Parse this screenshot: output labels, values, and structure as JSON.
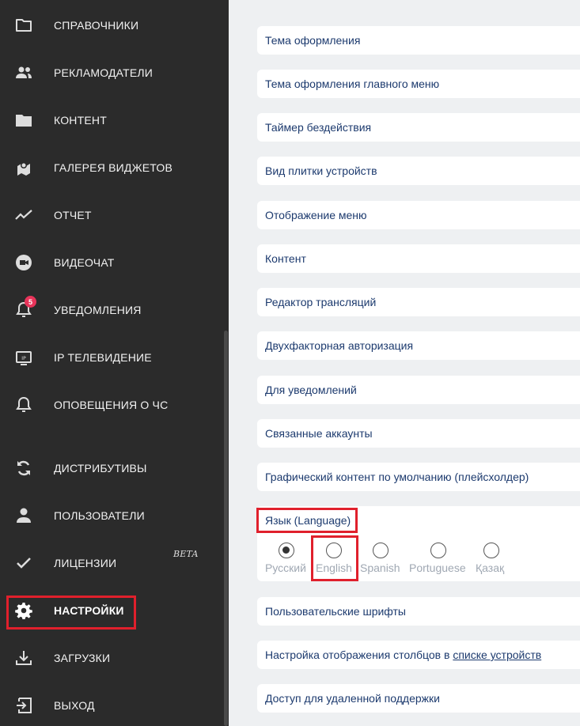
{
  "sidebar": {
    "items": [
      {
        "label": "СПРАВОЧНИКИ",
        "icon": "folder-icon"
      },
      {
        "label": "РЕКЛАМОДАТЕЛИ",
        "icon": "people-icon"
      },
      {
        "label": "КОНТЕНТ",
        "icon": "folder-filled-icon"
      },
      {
        "label": "ГАЛЕРЕЯ ВИДЖЕТОВ",
        "icon": "widgets-icon"
      },
      {
        "label": "ОТЧЕТ",
        "icon": "trend-line-icon"
      },
      {
        "label": "ВИДЕОЧАТ",
        "icon": "videochat-icon"
      },
      {
        "label": "УВЕДОМЛЕНИЯ",
        "icon": "bell-icon",
        "badge": "5"
      },
      {
        "label": "IP ТЕЛЕВИДЕНИЕ",
        "icon": "iptv-icon"
      },
      {
        "label": "ОПОВЕЩЕНИЯ О ЧС",
        "icon": "bell-outline-icon"
      },
      {
        "label": "ДИСТРИБУТИВЫ",
        "icon": "sync-icon"
      },
      {
        "label": "ПОЛЬЗОВАТЕЛИ",
        "icon": "user-icon"
      },
      {
        "label": "ЛИЦЕНЗИИ",
        "icon": "check-icon",
        "tag": "beta"
      },
      {
        "label": "НАСТРОЙКИ",
        "icon": "gear-icon",
        "active": true
      },
      {
        "label": "ЗАГРУЗКИ",
        "icon": "download-icon"
      },
      {
        "label": "ВЫХОД",
        "icon": "logout-icon"
      }
    ]
  },
  "settings": {
    "rows": [
      "Тема оформления",
      "Тема оформления главного меню",
      "Таймер бездействия",
      "Вид плитки устройств",
      "Отображение меню",
      "Контент",
      "Редактор трансляций",
      "Двухфакторная авторизация",
      "Для уведомлений",
      "Связанные аккаунты",
      "Графический контент по умолчанию (плейсхолдер)"
    ],
    "language": {
      "title": "Язык (Language)",
      "options": [
        "Русский",
        "English",
        "Spanish",
        "Portuguese",
        "Қазақ"
      ],
      "selected": "Русский"
    },
    "rows_after": {
      "fonts": "Пользовательские шрифты",
      "columns_prefix": "Настройка отображения столбцов в ",
      "columns_link": "списке устройств",
      "remote": "Доступ для удаленной поддержки"
    }
  },
  "colors": {
    "sidebar_bg": "#2b2b2b",
    "main_bg": "#eef0f2",
    "text_link": "#1c3a6e",
    "highlight": "#e0202c",
    "badge": "#e8345a"
  }
}
